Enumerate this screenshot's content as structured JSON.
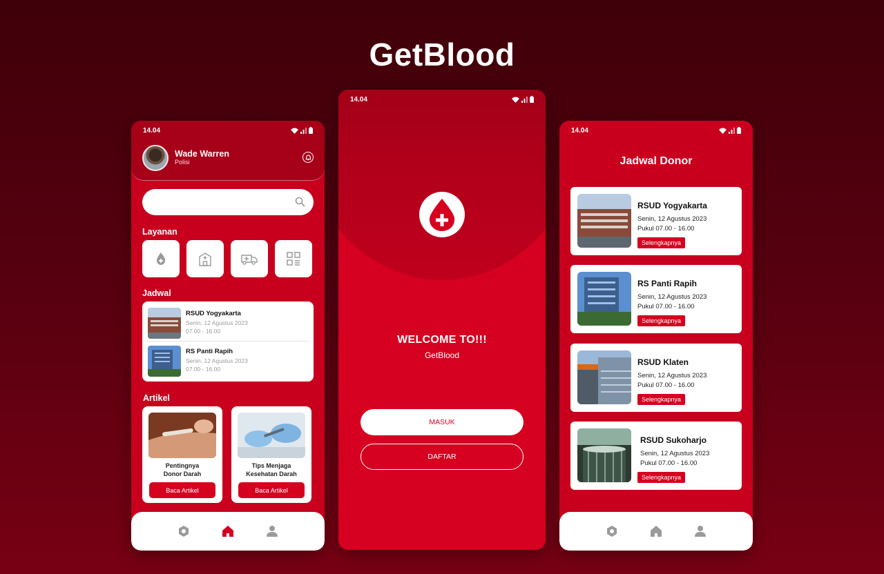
{
  "app_title": "GetBlood",
  "colors": {
    "primary": "#d6001f",
    "dark": "#a70019",
    "background": "#4a000c",
    "white": "#ffffff"
  },
  "status_bar": {
    "time": "14.04",
    "icons": [
      "wifi-icon",
      "signal-icon",
      "battery-icon"
    ]
  },
  "home_screen": {
    "user": {
      "name": "Wade Warren",
      "role": "Polisi"
    },
    "search": {
      "placeholder": ""
    },
    "services": {
      "title": "Layanan",
      "items": [
        "blood-drop-icon",
        "hospital-icon",
        "ambulance-icon",
        "qr-code-icon"
      ]
    },
    "schedule": {
      "title": "Jadwal",
      "items": [
        {
          "name": "RSUD Yogyakarta",
          "date": "Senin, 12 Agustus 2023",
          "time": "07.00 - 16.00"
        },
        {
          "name": "RS Panti Rapih",
          "date": "Senin, 12 Agustus 2023",
          "time": "07.00 - 16.00"
        }
      ]
    },
    "articles": {
      "title": "Artikel",
      "items": [
        {
          "title_line1": "Pentingnya",
          "title_line2": "Donor Darah",
          "button": "Baca Artikel"
        },
        {
          "title_line1": "Tips Menjaga",
          "title_line2": "Kesehatan Darah",
          "button": "Baca Artikel"
        }
      ]
    },
    "bottom_nav": [
      "settings-icon",
      "home-icon",
      "profile-icon"
    ]
  },
  "welcome_screen": {
    "title": "WELCOME TO!!!",
    "subtitle": "GetBlood",
    "login_button": "MASUK",
    "register_button": "DAFTAR"
  },
  "schedule_screen": {
    "title": "Jadwal Donor",
    "items": [
      {
        "name": "RSUD Yogyakarta",
        "date": "Senin, 12 Agustus 2023",
        "time": "Pukul 07.00 - 16.00",
        "button": "Selengkapnya"
      },
      {
        "name": "RS Panti Rapih",
        "date": "Senin, 12 Agustus 2023",
        "time": "Pukul 07.00 - 16.00",
        "button": "Selengkapnya"
      },
      {
        "name": "RSUD Klaten",
        "date": "Senin, 12 Agustus 2023",
        "time": "Pukul 07.00 - 16.00",
        "button": "Selengkapnya"
      },
      {
        "name": "RSUD Sukoharjo",
        "date": "Senin, 12 Agustus 2023",
        "time": "Pukul 07.00 - 16.00",
        "button": "Selengkapnya"
      }
    ],
    "bottom_nav": [
      "settings-icon",
      "home-icon",
      "profile-icon"
    ]
  }
}
